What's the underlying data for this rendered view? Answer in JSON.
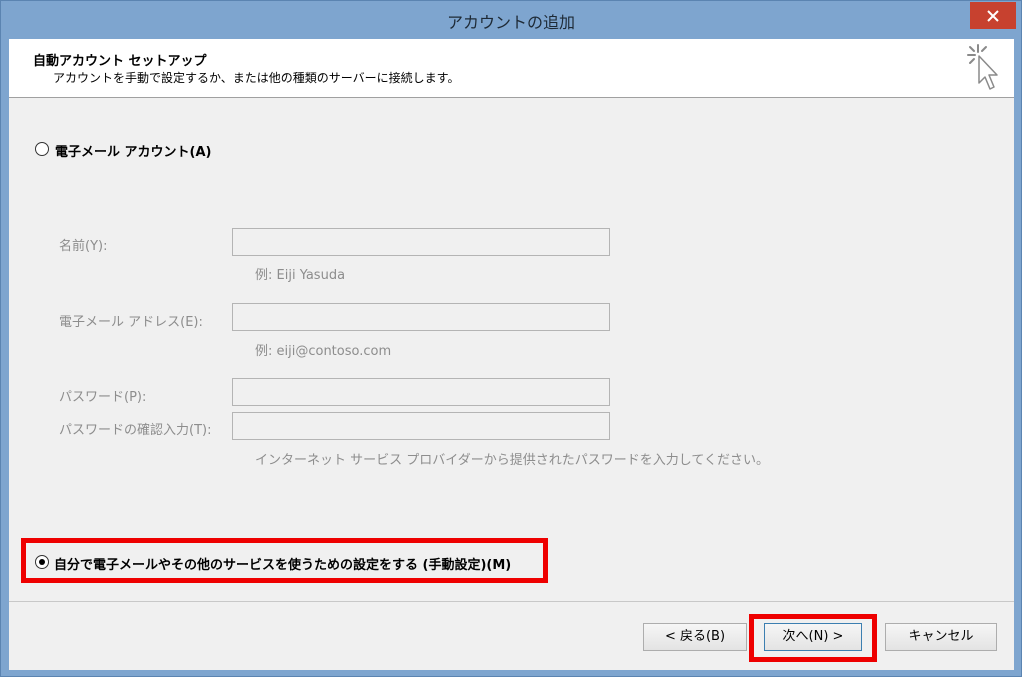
{
  "window": {
    "title": "アカウントの追加",
    "close_glyph": "✕"
  },
  "header": {
    "title": "自動アカウント セットアップ",
    "subtitle": "アカウントを手動で設定するか、または他の種類のサーバーに接続します。",
    "icon": "cursor-sparkle-icon"
  },
  "options": {
    "email_account": {
      "label": "電子メール アカウント(A)",
      "selected": false
    },
    "manual_setup": {
      "label": "自分で電子メールやその他のサービスを使うための設定をする (手動設定)(M)",
      "selected": true
    }
  },
  "fields": {
    "name": {
      "label": "名前(Y):",
      "value": "",
      "hint": "例: Eiji Yasuda"
    },
    "email": {
      "label": "電子メール アドレス(E):",
      "value": "",
      "hint": "例: eiji@contoso.com"
    },
    "password": {
      "label": "パスワード(P):",
      "value": ""
    },
    "password_confirm": {
      "label": "パスワードの確認入力(T):",
      "value": "",
      "hint": "インターネット サービス プロバイダーから提供されたパスワードを入力してください。"
    }
  },
  "buttons": {
    "back": "< 戻る(B)",
    "next": "次へ(N) >",
    "cancel": "キャンセル"
  },
  "colors": {
    "highlight": "#ee0000",
    "close": "#c7412f",
    "frame": "#7ea5cf"
  }
}
